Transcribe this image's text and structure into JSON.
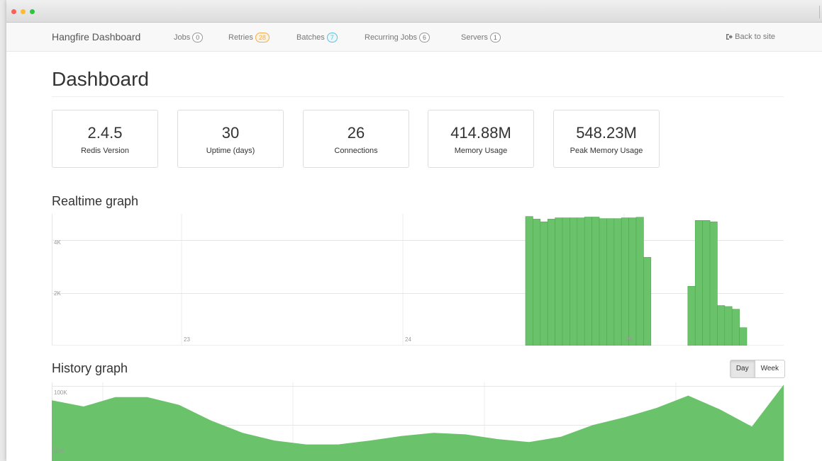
{
  "colors": {
    "bar": "#6ac36a",
    "bar_stroke": "#4ea84e",
    "area": "#6ac36a"
  },
  "nav": {
    "brand": "Hangfire Dashboard",
    "links": [
      {
        "label": "Jobs",
        "count": "0"
      },
      {
        "label": "Retries",
        "count": "28"
      },
      {
        "label": "Batches",
        "count": "7"
      },
      {
        "label": "Recurring Jobs",
        "count": "6"
      },
      {
        "label": "Servers",
        "count": "1"
      }
    ],
    "back": "Back to site"
  },
  "page_title": "Dashboard",
  "metrics": [
    {
      "value": "2.4.5",
      "label": "Redis Version"
    },
    {
      "value": "30",
      "label": "Uptime (days)"
    },
    {
      "value": "26",
      "label": "Connections"
    },
    {
      "value": "414.88M",
      "label": "Memory Usage"
    },
    {
      "value": "548.23M",
      "label": "Peak Memory Usage"
    }
  ],
  "realtime": {
    "title": "Realtime graph",
    "y_ticks": [
      "4K",
      "2K"
    ],
    "x_ticks": [
      "23",
      "24",
      "25"
    ]
  },
  "history": {
    "title": "History graph",
    "y_ticks": [
      "100K",
      "50K"
    ],
    "buttons": {
      "day": "Day",
      "week": "Week"
    }
  },
  "chart_data": [
    {
      "type": "bar",
      "title": "Realtime graph",
      "ylim": [
        0,
        5000
      ],
      "yticks": [
        2000,
        4000
      ],
      "xtick_labels": [
        "23",
        "24",
        "25"
      ],
      "series": [
        {
          "values": [
            4900,
            4800,
            4700,
            4800,
            4850,
            4850,
            4850,
            4850,
            4880,
            4880,
            4820,
            4820,
            4820,
            4850,
            4850,
            4870,
            3350,
            null,
            null,
            null,
            null,
            null,
            2250,
            4750,
            4750,
            4700,
            1520,
            1480,
            1380,
            680
          ]
        }
      ]
    },
    {
      "type": "area",
      "title": "History graph",
      "yticks": [
        50000,
        100000
      ],
      "ylim": [
        0,
        105000
      ],
      "series": [
        {
          "values": [
            82000,
            74000,
            86000,
            86000,
            76000,
            56000,
            40000,
            30000,
            25000,
            25000,
            30000,
            36000,
            40000,
            38000,
            32000,
            28000,
            35000,
            50000,
            60000,
            72000,
            88000,
            70000,
            48000,
            102000
          ]
        }
      ]
    }
  ]
}
